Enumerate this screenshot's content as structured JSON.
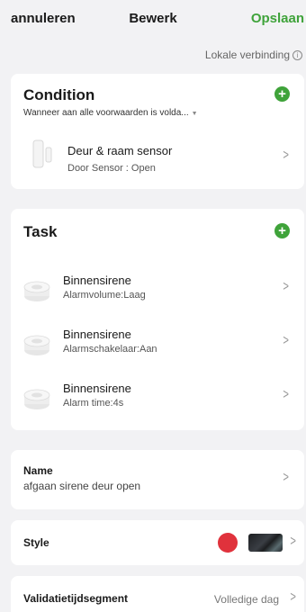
{
  "topbar": {
    "cancel_label": "annuleren",
    "title": "Bewerk",
    "save_label": "Opslaan"
  },
  "local_connection": {
    "label": "Lokale verbinding",
    "info_icon": "ⓘ"
  },
  "condition": {
    "title": "Condition",
    "subtitle": "Wanneer aan alle voorwaarden is volda...",
    "items": [
      {
        "name": "Deur & raam sensor",
        "desc": "Door Sensor : Open",
        "icon": "door-sensor-icon"
      }
    ]
  },
  "task": {
    "title": "Task",
    "items": [
      {
        "name": "Binnensirene",
        "desc": "Alarmvolume:Laag",
        "icon": "siren-icon"
      },
      {
        "name": "Binnensirene",
        "desc": "Alarmschakelaar:Aan",
        "icon": "siren-icon"
      },
      {
        "name": "Binnensirene",
        "desc": "Alarm time:4s",
        "icon": "siren-icon"
      }
    ]
  },
  "name_section": {
    "label": "Name",
    "value": "afgaan sirene deur open"
  },
  "style_section": {
    "label": "Style",
    "color": "#e0323c"
  },
  "validity_section": {
    "label": "Validatietijdsegment",
    "value": "Volledige dag"
  },
  "colors": {
    "accent": "#3fa33a",
    "background": "#f2f2f4",
    "card": "#ffffff"
  }
}
